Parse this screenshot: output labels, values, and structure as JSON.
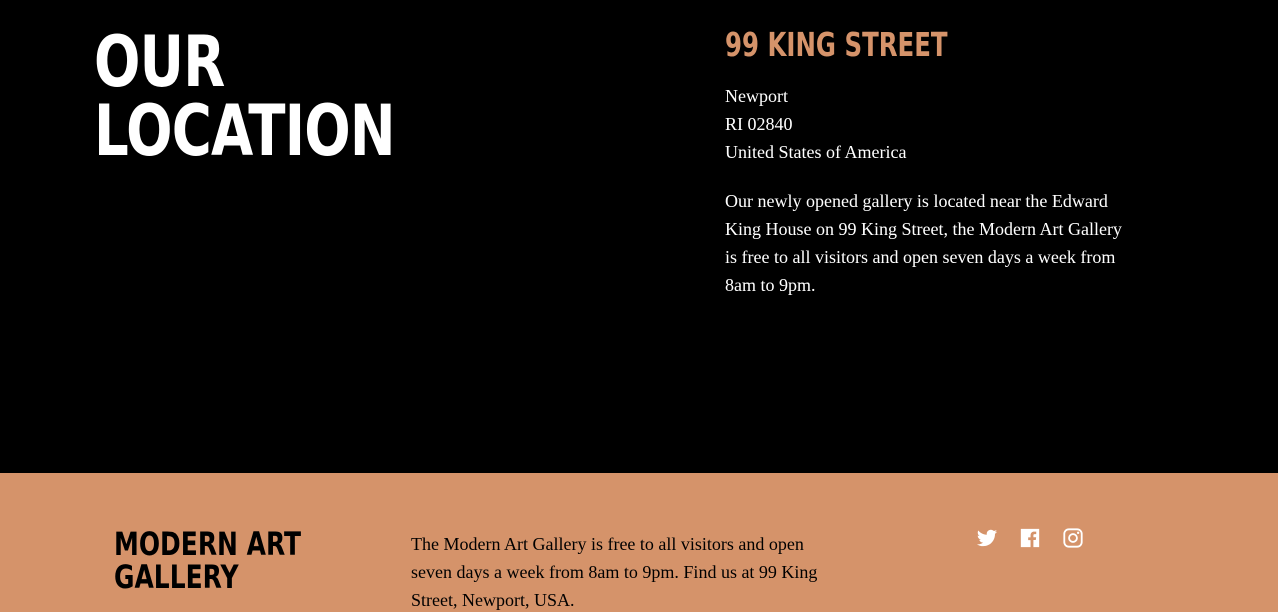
{
  "location": {
    "heading_line1": "OUR",
    "heading_line2": "LOCATION",
    "address_title": "99 KING STREET",
    "address_lines": [
      "Newport",
      "RI 02840",
      "United States of America"
    ],
    "description": "Our newly opened gallery is located near the Edward King House on 99 King Street, the Modern Art Gallery is free to all visitors and open seven days a week from 8am to 9pm."
  },
  "footer": {
    "logo_line1": "MODERN ART",
    "logo_line2": "GALLERY",
    "text": "The Modern Art Gallery is free to all visitors and open seven days a week from 8am to 9pm. Find us at 99 King Street, Newport, USA.",
    "social": [
      {
        "icon": "twitter-icon"
      },
      {
        "icon": "facebook-icon"
      },
      {
        "icon": "instagram-icon"
      }
    ]
  },
  "colors": {
    "accent": "#d5936a",
    "background": "#000000",
    "text_light": "#ffffff"
  }
}
